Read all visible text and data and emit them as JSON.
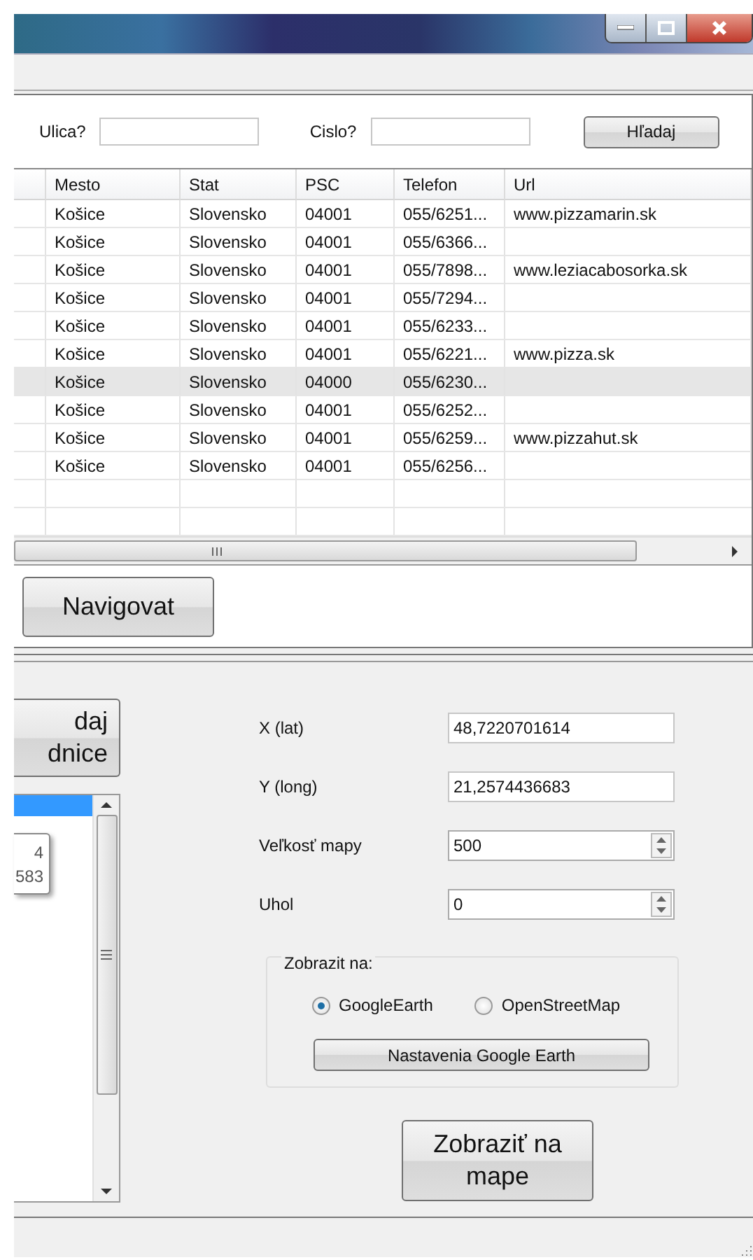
{
  "search": {
    "street_label": "Ulica?",
    "number_label": "Cislo?",
    "button": "Hľadaj"
  },
  "table": {
    "columns": [
      "Mesto",
      "Stat",
      "PSC",
      "Telefon",
      "Url"
    ],
    "rows": [
      {
        "cells": [
          "Košice",
          "Slovensko",
          "04001",
          "055/6251...",
          "www.pizzamarin.sk"
        ],
        "selected": false
      },
      {
        "cells": [
          "Košice",
          "Slovensko",
          "04001",
          "055/6366...",
          ""
        ],
        "selected": false
      },
      {
        "cells": [
          "Košice",
          "Slovensko",
          "04001",
          "055/7898...",
          "www.leziacabosorka.sk"
        ],
        "selected": false
      },
      {
        "cells": [
          "Košice",
          "Slovensko",
          "04001",
          "055/7294...",
          ""
        ],
        "selected": false
      },
      {
        "cells": [
          "Košice",
          "Slovensko",
          "04001",
          "055/6233...",
          ""
        ],
        "selected": false
      },
      {
        "cells": [
          "Košice",
          "Slovensko",
          "04001",
          "055/6221...",
          "www.pizza.sk"
        ],
        "selected": false
      },
      {
        "cells": [
          "Košice",
          "Slovensko",
          "04000",
          "055/6230...",
          ""
        ],
        "selected": true
      },
      {
        "cells": [
          "Košice",
          "Slovensko",
          "04001",
          "055/6252...",
          ""
        ],
        "selected": false
      },
      {
        "cells": [
          "Košice",
          "Slovensko",
          "04001",
          "055/6259...",
          "www.pizzahut.sk"
        ],
        "selected": false
      },
      {
        "cells": [
          "Košice",
          "Slovensko",
          "04001",
          "055/6256...",
          ""
        ],
        "selected": false
      }
    ]
  },
  "navigate_button": "Navigovat",
  "coords_button": [
    "daj",
    "dnice"
  ],
  "list": {
    "items": [
      {
        "selected": true
      }
    ]
  },
  "tooltip": [
    "4",
    "583"
  ],
  "form": [
    {
      "label": "X (lat)",
      "value": "48,7220701614",
      "kind": "text"
    },
    {
      "label": "Y (long)",
      "value": "21,2574436683",
      "kind": "text"
    },
    {
      "label": "Veľkosť mapy",
      "value": "500",
      "kind": "spin"
    },
    {
      "label": "Uhol",
      "value": "0",
      "kind": "spin"
    }
  ],
  "display_group": {
    "title": "Zobrazit na:",
    "options": [
      {
        "label": "GoogleEarth",
        "selected": true
      },
      {
        "label": "OpenStreetMap",
        "selected": false
      }
    ],
    "button": "Nastavenia Google Earth"
  },
  "show_button": "Zobraziť na mape"
}
